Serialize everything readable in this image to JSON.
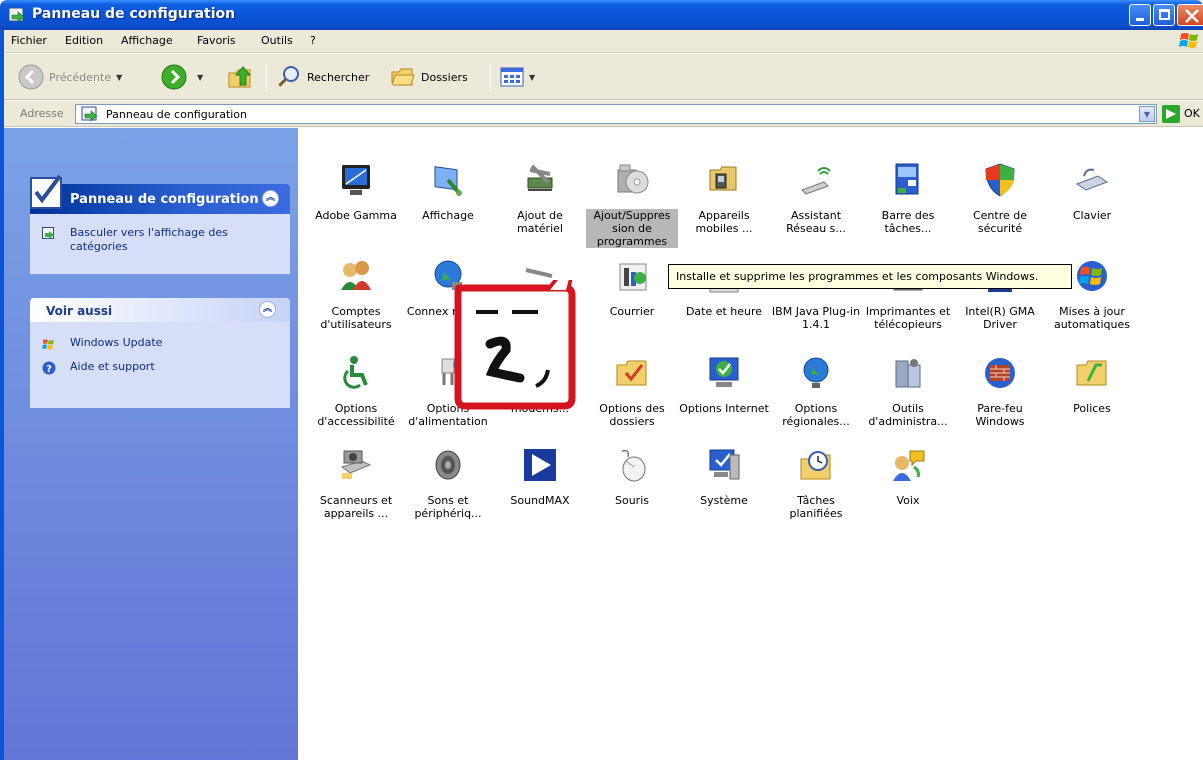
{
  "window": {
    "title": "Panneau de configuration"
  },
  "menu": [
    "Fichier",
    "Edition",
    "Affichage",
    "Favoris",
    "Outils",
    "?"
  ],
  "toolbar": {
    "back_label": "Précédente",
    "search_label": "Rechercher",
    "folders_label": "Dossiers"
  },
  "address": {
    "label": "Adresse",
    "value": "Panneau de configuration",
    "go_label": "OK"
  },
  "taskpane": {
    "panel1_title": "Panneau de configuration",
    "switch_view_label": "Basculer vers l'affichage des catégories",
    "see_also_title": "Voir aussi",
    "see_also": [
      "Windows Update",
      "Aide et support"
    ]
  },
  "items": [
    "Adobe Gamma",
    "Affichage",
    "Ajout de matériel",
    "Ajout/Suppres sion de programmes",
    "Appareils mobiles ...",
    "Assistant Réseau s...",
    "Barre des tâches...",
    "Centre de sécurité",
    "Clavier",
    "Comptes d'utilisateurs",
    "Connex réseau",
    "",
    "Courrier",
    "Date et heure",
    "IBM Java Plug-in 1.4.1",
    "Imprimantes et télécopieurs",
    "Intel(R) GMA Driver",
    "Mises à jour automatiques",
    "Options d'accessibilité",
    "Options d'alimentation",
    "modems...",
    "Options des dossiers",
    "Options Internet",
    "Options régionales...",
    "Outils d'administra...",
    "Pare-feu Windows",
    "Polices",
    "Scanneurs et appareils ...",
    "Sons et périphériq...",
    "SoundMAX",
    "Souris",
    "Système",
    "Tâches planifiées",
    "Voix"
  ],
  "tooltip": "Installe et supprime les programmes et les composants Windows.",
  "colors": {
    "titlebar": "#0a53d8",
    "chrome": "#ece9d8",
    "taskpane": "#6f8fe0",
    "tooltip_bg": "#ffffe1",
    "bubble_border": "#d4141e"
  }
}
